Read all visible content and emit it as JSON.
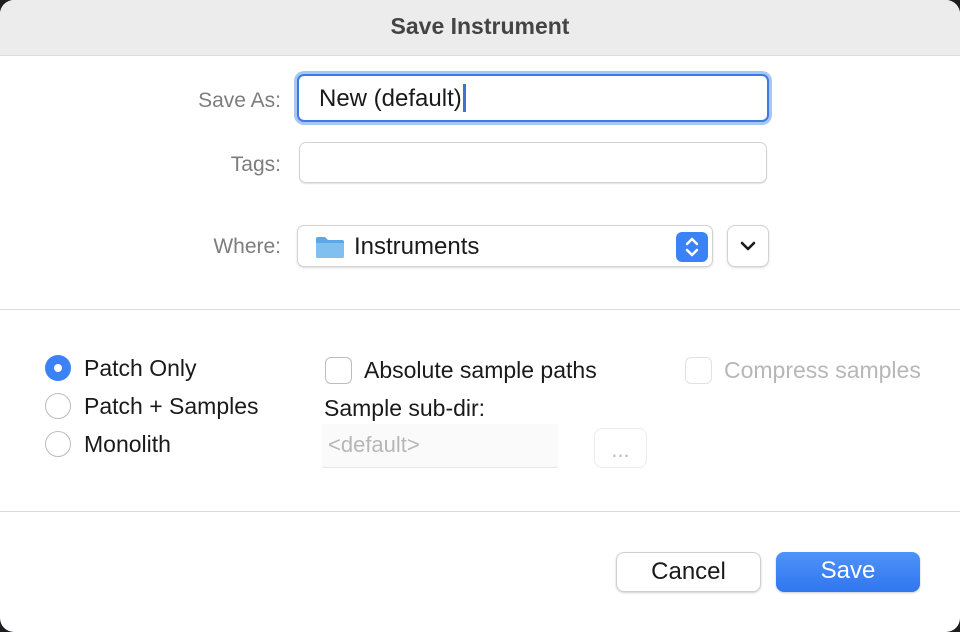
{
  "dialog": {
    "title": "Save Instrument"
  },
  "save_as": {
    "label": "Save As:",
    "value": "New (default)"
  },
  "tags": {
    "label": "Tags:",
    "value": ""
  },
  "where": {
    "label": "Where:",
    "value": "Instruments",
    "icon": "folder-icon"
  },
  "options": {
    "save_mode": [
      {
        "label": "Patch Only",
        "selected": true
      },
      {
        "label": "Patch + Samples",
        "selected": false
      },
      {
        "label": "Monolith",
        "selected": false
      }
    ],
    "absolute_sample_paths": {
      "label": "Absolute sample paths",
      "checked": false
    },
    "compress_samples": {
      "label": "Compress samples",
      "checked": false,
      "enabled": false
    },
    "sample_subdir": {
      "label": "Sample sub-dir:",
      "placeholder": "<default>",
      "enabled": false
    },
    "browse_label": "..."
  },
  "buttons": {
    "cancel": "Cancel",
    "save": "Save"
  },
  "colors": {
    "accent": "#3b82f6",
    "focus_ring": "#a9c6f1",
    "disabled_text": "#b7b7b7"
  }
}
